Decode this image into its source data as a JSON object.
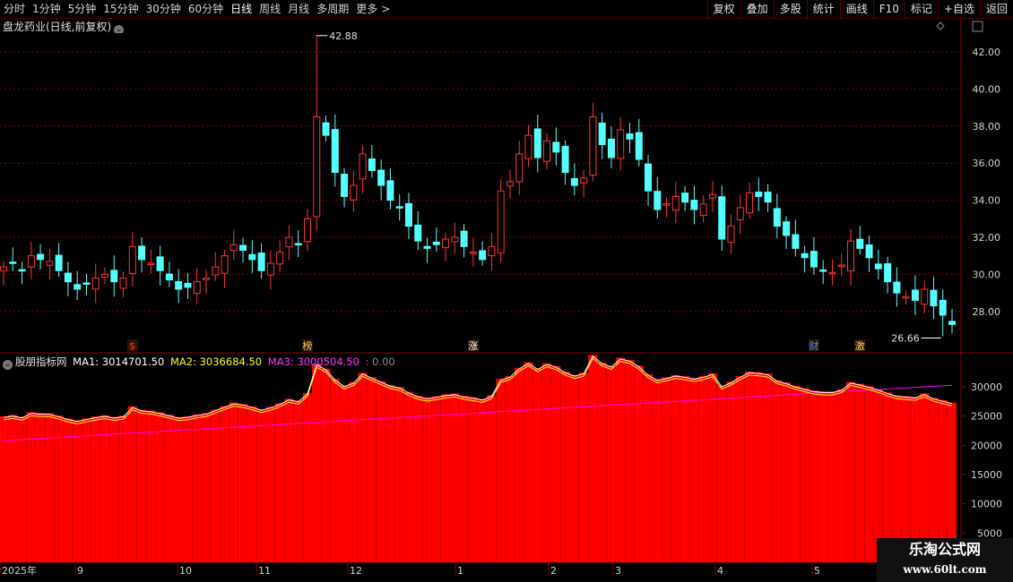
{
  "toolbar": {
    "periods": [
      "分时",
      "1分钟",
      "5分钟",
      "15分钟",
      "30分钟",
      "60分钟",
      "日线",
      "周线",
      "月线",
      "多周期",
      "更多"
    ],
    "more_arrow": ">",
    "active_period": "日线",
    "right_buttons": [
      "复权",
      "叠加",
      "多股",
      "统计",
      "画线",
      "F10",
      "标记",
      "+自选",
      "返回"
    ]
  },
  "main_chart": {
    "title": "盘龙药业(日线,前复权)",
    "title_dropdown_icon": "chevron-down-icon",
    "price_axis_labels": [
      "42.00",
      "40.00",
      "38.00",
      "36.00",
      "34.00",
      "32.00",
      "30.00",
      "28.00"
    ],
    "high_label": "42.88",
    "low_label": "26.66",
    "event_markers": [
      {
        "label": "$",
        "color": "#ff3030"
      },
      {
        "label": "榜",
        "color": "#ffcc66"
      },
      {
        "label": "涨",
        "color": "#ffffff"
      },
      {
        "label": "财",
        "color": "#3399ff"
      },
      {
        "label": "激",
        "color": "#ffcc66"
      }
    ],
    "colors": {
      "up": "#ff3232",
      "down": "#54ffff",
      "grid": "#8a0000"
    }
  },
  "indicator": {
    "name": "股朋指标网",
    "ma1_label": "MA1: 3014701.50",
    "ma2_label": "MA2: 3036684.50",
    "ma3_label": "MA3: 3000504.50",
    "extra_label": ": 0.00",
    "axis_labels": [
      "30000",
      "25000",
      "20000",
      "15000",
      "10000",
      "5000"
    ],
    "colors": {
      "bar": "#ff0000",
      "ma1": "#ffffff",
      "ma2": "#ffff00",
      "ma3": "#ff00ff"
    }
  },
  "time_axis": {
    "labels": [
      "2025年",
      "9",
      "10",
      "11",
      "12",
      "1",
      "2",
      "3",
      "4",
      "5"
    ]
  },
  "watermark": {
    "line1": "乐淘公式网",
    "line2": "www.60lt.com"
  },
  "chart_data": {
    "type": "candlestick",
    "title": "盘龙药业(日线,前复权)",
    "ylim": [
      26.5,
      43.5
    ],
    "high": 42.88,
    "low": 26.66,
    "close_series": [
      30.4,
      30.6,
      30.2,
      31.0,
      30.8,
      30.7,
      30.2,
      29.6,
      29.2,
      29.5,
      29.8,
      30.0,
      29.6,
      29.8,
      31.5,
      30.8,
      30.6,
      30.2,
      29.7,
      29.2,
      29.3,
      29.6,
      29.8,
      30.4,
      31.0,
      31.6,
      31.3,
      30.8,
      30.2,
      30.6,
      31.2,
      32.0,
      31.6,
      33.0,
      38.5,
      37.5,
      35.5,
      34.2,
      34.8,
      36.5,
      35.6,
      34.8,
      34.0,
      33.6,
      32.6,
      31.8,
      31.4,
      31.6,
      31.9,
      32.0,
      31.5,
      31.2,
      30.8,
      31.5,
      34.5,
      35.0,
      36.5,
      37.5,
      36.3,
      37.2,
      36.6,
      35.5,
      34.8,
      35.2,
      38.5,
      37.0,
      36.3,
      37.8,
      37.3,
      36.2,
      34.5,
      33.5,
      33.8,
      34.2,
      33.9,
      33.5,
      33.8,
      34.3,
      31.9,
      32.6,
      33.6,
      34.4,
      34.2,
      33.9,
      32.6,
      32.1,
      31.4,
      30.9,
      30.4,
      30.2,
      30.1,
      30.5,
      31.8,
      31.4,
      30.9,
      30.3,
      29.6,
      29.0,
      28.8,
      28.6,
      29.2,
      28.3,
      27.8,
      27.3
    ]
  }
}
